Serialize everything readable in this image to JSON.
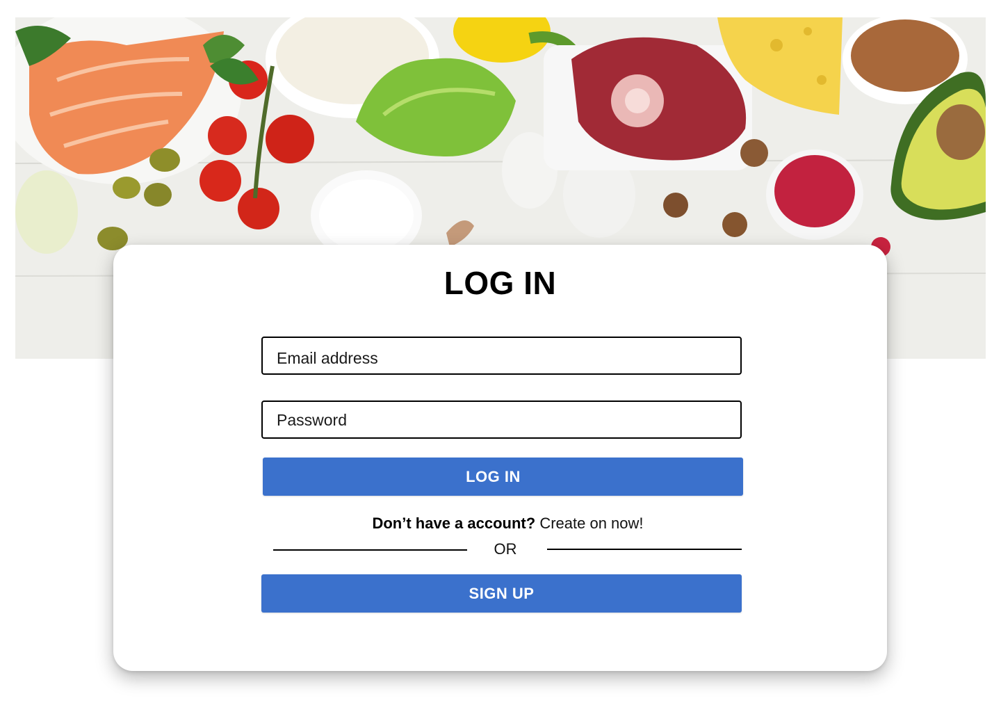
{
  "hero": {
    "image_icon": "healthy-food-photo"
  },
  "login_card": {
    "title": "LOG IN",
    "email_placeholder": "Email address",
    "password_placeholder": "Password",
    "login_button_label": "LOG IN",
    "account_question": "Don’t  have a account?",
    "create_link_label": "Create on now!",
    "divider_label": "OR",
    "signup_button_label": "SIGN UP"
  },
  "colors": {
    "button_blue": "#3b71cc",
    "field_border": "#000000",
    "card_background": "#ffffff"
  }
}
